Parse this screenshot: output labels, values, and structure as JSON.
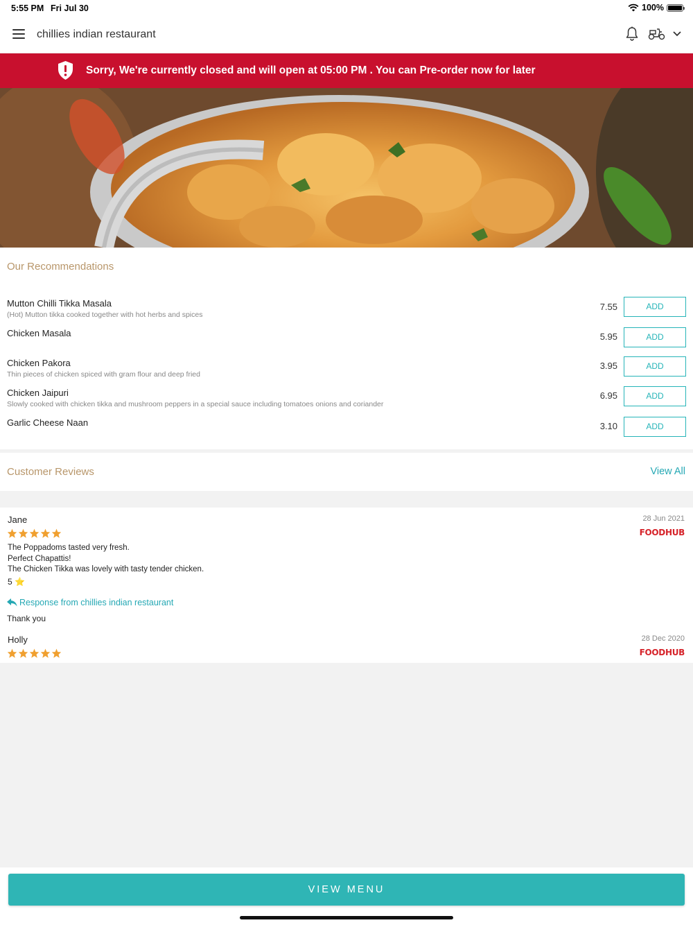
{
  "status_bar": {
    "time": "5:55 PM",
    "date": "Fri Jul 30",
    "battery": "100%"
  },
  "header": {
    "title": "chillies indian restaurant",
    "icons": [
      "menu-icon",
      "bell-icon",
      "scooter-icon",
      "chevron-down-icon"
    ]
  },
  "banner": {
    "text": "Sorry, We're currently closed and will open at 05:00 PM . You can Pre-order now for later",
    "color": "#c8102e"
  },
  "recommendations": {
    "heading": "Our Recommendations",
    "add_label": "ADD",
    "items": [
      {
        "name": "Mutton Chilli Tikka Masala",
        "description": "(Hot) Mutton tikka cooked together with hot herbs and spices",
        "price": "7.55"
      },
      {
        "name": "Chicken Masala",
        "description": "",
        "price": "5.95"
      },
      {
        "name": "Chicken Pakora",
        "description": "Thin pieces of chicken spiced with gram flour and deep fried",
        "price": "3.95"
      },
      {
        "name": "Chicken Jaipuri",
        "description": "Slowly cooked with chicken tikka and mushroom peppers in a special sauce including tomatoes onions and coriander",
        "price": "6.95"
      },
      {
        "name": "Garlic Cheese Naan",
        "description": "",
        "price": "3.10"
      }
    ]
  },
  "reviews": {
    "heading": "Customer Reviews",
    "view_all": "View All",
    "source_logo": "FOODHUB",
    "items": [
      {
        "name": "Jane",
        "date": "28 Jun 2021",
        "rating": 5,
        "lines": [
          "The Poppadoms tasted very fresh.",
          "Perfect Chapattis!",
          "The Chicken Tikka was lovely with tasty tender chicken.",
          "5 ⭐"
        ],
        "response_label": "Response from chillies indian restaurant",
        "response": "Thank you"
      },
      {
        "name": "Holly",
        "date": "28 Dec 2020",
        "rating": 5
      }
    ]
  },
  "footer": {
    "view_menu": "VIEW MENU",
    "accent": "#2fb5b5"
  }
}
